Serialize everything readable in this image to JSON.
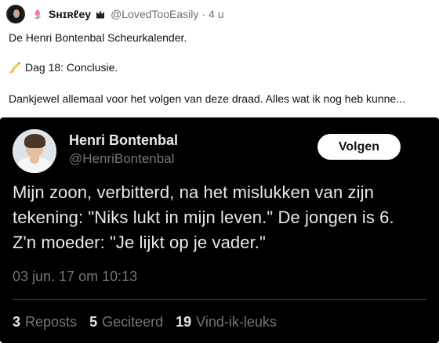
{
  "post": {
    "author_name": "Sʜɪʀℓey",
    "handle": "@LovedTooEasily",
    "separator": "·",
    "time": "4 u",
    "icons": [
      "avatar",
      "flower-icon",
      "crown-icon",
      "pencil-hand-icon"
    ],
    "lines": [
      "De Henri Bontenbal Scheurkalender.",
      "Dag 18: Conclusie.",
      "Dankjewel allemaal voor het volgen van deze draad. Alles wat ik nog heb kunne..."
    ]
  },
  "embedded_tweet": {
    "name": "Henri Bontenbal",
    "handle": "@HenriBontenbal",
    "follow_label": "Volgen",
    "text_lines": [
      "Mijn zoon, verbitterd, na het mislukken van zijn",
      "tekening: \"Niks lukt in mijn leven.\" De jongen is 6.",
      "Z'n moeder: \"Je lijkt op je vader.\""
    ],
    "date": "03 jun. 17 om 10:13",
    "stats": [
      {
        "count": "3",
        "label": "Reposts"
      },
      {
        "count": "5",
        "label": "Geciteerd"
      },
      {
        "count": "19",
        "label": "Vind-ik-leuks"
      }
    ]
  },
  "colors": {
    "background": "#ffffff",
    "tweet_background": "#000000",
    "muted": "#71767b",
    "text_dark": "#0f1419",
    "text_light": "#e7e9ea"
  }
}
